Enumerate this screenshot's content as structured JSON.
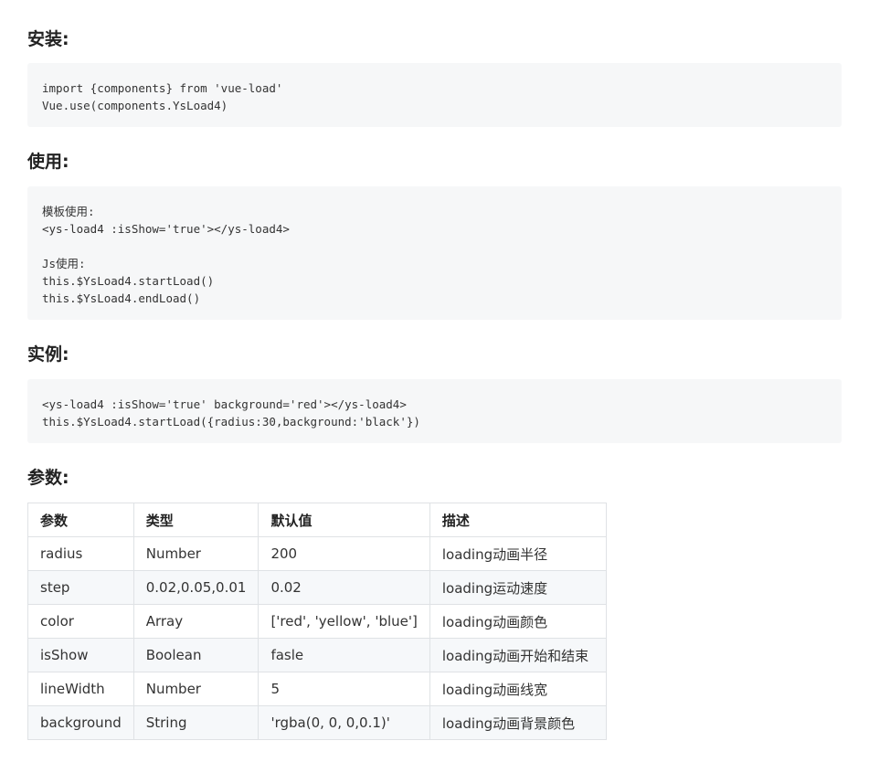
{
  "sections": {
    "install": {
      "heading": "安装:",
      "code": [
        "import {components} from 'vue-load'",
        "Vue.use(components.YsLoad4)"
      ]
    },
    "usage": {
      "heading": "使用:",
      "code": [
        "模板使用:",
        "<ys-load4 :isShow='true'></ys-load4>",
        "",
        "Js使用:",
        "this.$YsLoad4.startLoad()",
        "this.$YsLoad4.endLoad()"
      ]
    },
    "example": {
      "heading": "实例:",
      "code": [
        "<ys-load4 :isShow='true' background='red'></ys-load4>",
        "this.$YsLoad4.startLoad({radius:30,background:'black'})"
      ]
    },
    "params": {
      "heading": "参数:",
      "headers": [
        "参数",
        "类型",
        "默认值",
        "描述"
      ],
      "rows": [
        [
          "radius",
          "Number",
          "200",
          "loading动画半径"
        ],
        [
          "step",
          "0.02,0.05,0.01",
          "0.02",
          "loading运动速度"
        ],
        [
          "color",
          "Array",
          "['red', 'yellow', 'blue']",
          "loading动画颜色"
        ],
        [
          "isShow",
          "Boolean",
          "fasle",
          "loading动画开始和结束"
        ],
        [
          "lineWidth",
          "Number",
          "5",
          "loading动画线宽"
        ],
        [
          "background",
          "String",
          "'rgba(0, 0, 0,0.1)'",
          "loading动画背景颜色"
        ]
      ]
    }
  }
}
